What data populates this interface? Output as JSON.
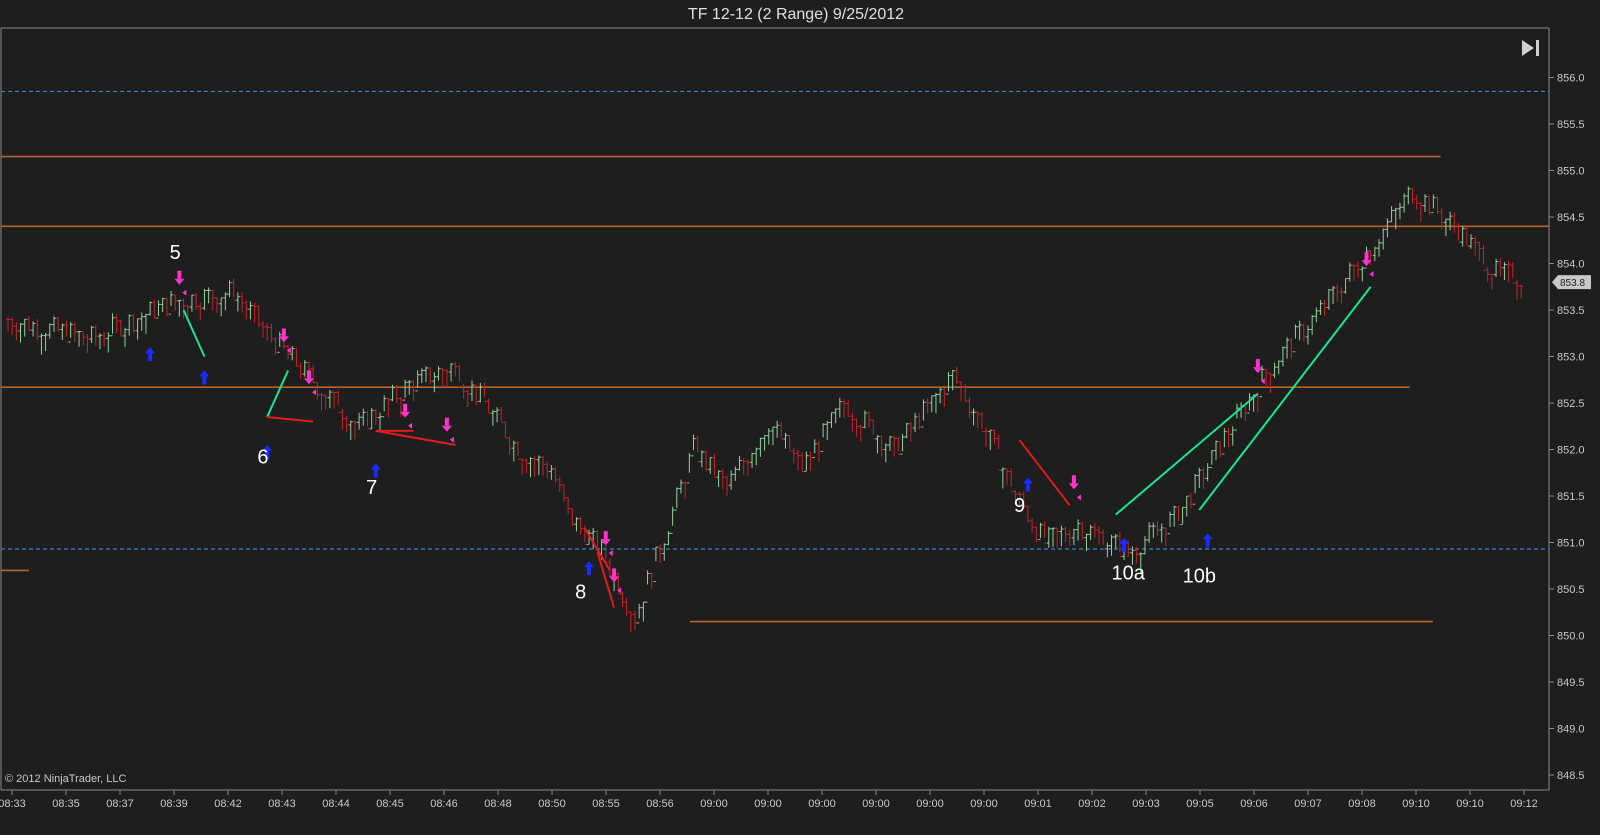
{
  "colors": {
    "background": "#1e1e1e",
    "plot_bg": "#1e1e1e",
    "axis": "#8a8a8a",
    "up_bar": "#8fd19e",
    "down_bar": "#c8222a",
    "level_line": "#b8632a",
    "dashed_line": "#3a83c9",
    "trade_win": "#19e68c",
    "trade_loss": "#e21b1b",
    "sell_marker": "#ff33cc",
    "buy_marker": "#1a2cff",
    "price_tag": "#c8c8c8"
  },
  "chart_data": {
    "type": "ohlc",
    "title": "TF 12-12 (2 Range)  9/25/2012",
    "ylim": [
      848.5,
      856.3
    ],
    "y_ticks": [
      "856.0",
      "855.5",
      "855.0",
      "854.5",
      "854.0",
      "853.5",
      "853.0",
      "852.5",
      "852.0",
      "851.5",
      "851.0",
      "850.5",
      "850.0",
      "849.5",
      "849.0",
      "848.5"
    ],
    "x_ticks": [
      "08:33",
      "08:35",
      "08:37",
      "08:39",
      "08:42",
      "08:43",
      "08:44",
      "08:45",
      "08:46",
      "08:48",
      "08:50",
      "08:55",
      "08:56",
      "09:00",
      "09:00",
      "09:00",
      "09:00",
      "09:00",
      "09:00",
      "09:01",
      "09:02",
      "09:03",
      "09:05",
      "09:06",
      "09:07",
      "09:08",
      "09:10",
      "09:10",
      "09:12"
    ],
    "last_price": "853.8",
    "copyright": "© 2012 NinjaTrader, LLC",
    "horizontal_levels": [
      {
        "price": 855.85,
        "style": "dashed",
        "from": 0,
        "to": 1
      },
      {
        "price": 855.15,
        "style": "solid",
        "from": 0,
        "to": 0.93
      },
      {
        "price": 854.4,
        "style": "solid",
        "from": 0,
        "to": 1
      },
      {
        "price": 852.67,
        "style": "solid",
        "from": 0,
        "to": 0.91
      },
      {
        "price": 850.93,
        "style": "dashed",
        "from": 0,
        "to": 1
      },
      {
        "price": 850.7,
        "style": "solid",
        "from": 0,
        "to": 0.018
      },
      {
        "price": 850.15,
        "style": "solid",
        "from": 0.445,
        "to": 0.925
      }
    ],
    "price_path": [
      [
        0,
        853.4
      ],
      [
        20,
        853.2
      ],
      [
        40,
        853.6
      ],
      [
        54,
        853.7
      ],
      [
        62,
        853.25
      ],
      [
        76,
        852.6
      ],
      [
        84,
        852.25
      ],
      [
        96,
        852.7
      ],
      [
        106,
        852.9
      ],
      [
        114,
        852.5
      ],
      [
        122,
        852.0
      ],
      [
        130,
        851.8
      ],
      [
        134,
        851.3
      ],
      [
        142,
        850.9
      ],
      [
        150,
        850.2
      ],
      [
        158,
        851.2
      ],
      [
        164,
        852.0
      ],
      [
        172,
        851.6
      ],
      [
        182,
        852.3
      ],
      [
        190,
        851.8
      ],
      [
        200,
        852.5
      ],
      [
        212,
        852.0
      ],
      [
        226,
        852.8
      ],
      [
        234,
        852.2
      ],
      [
        240,
        851.6
      ],
      [
        248,
        851.0
      ],
      [
        256,
        851.2
      ],
      [
        268,
        850.9
      ],
      [
        280,
        851.3
      ],
      [
        292,
        852.2
      ],
      [
        302,
        852.9
      ],
      [
        314,
        853.5
      ],
      [
        328,
        854.3
      ],
      [
        336,
        854.8
      ],
      [
        346,
        854.4
      ],
      [
        356,
        853.9
      ],
      [
        362,
        853.85
      ]
    ],
    "trades": [
      {
        "from": [
          42,
          853.5
        ],
        "to": [
          47,
          853.0
        ],
        "result": "win"
      },
      {
        "from": [
          62,
          852.35
        ],
        "to": [
          67,
          852.85
        ],
        "result": "win"
      },
      {
        "from": [
          62,
          852.35
        ],
        "to": [
          73,
          852.3
        ],
        "result": "loss"
      },
      {
        "from": [
          88,
          852.2
        ],
        "to": [
          97,
          852.2
        ],
        "result": "loss"
      },
      {
        "from": [
          88,
          852.2
        ],
        "to": [
          107,
          852.05
        ],
        "result": "loss"
      },
      {
        "from": [
          138,
          851.15
        ],
        "to": [
          144,
          850.7
        ],
        "result": "loss"
      },
      {
        "from": [
          141,
          850.9
        ],
        "to": [
          145,
          850.3
        ],
        "result": "loss"
      },
      {
        "from": [
          242,
          852.1
        ],
        "to": [
          254,
          851.4
        ],
        "result": "loss"
      },
      {
        "from": [
          265,
          851.3
        ],
        "to": [
          299,
          852.6
        ],
        "result": "win"
      },
      {
        "from": [
          285,
          851.35
        ],
        "to": [
          326,
          853.75
        ],
        "result": "win"
      }
    ],
    "annotations": [
      {
        "label": "5",
        "bar": 40,
        "price": 854.05
      },
      {
        "label": "6",
        "bar": 61,
        "price": 851.85
      },
      {
        "label": "7",
        "bar": 87,
        "price": 851.52
      },
      {
        "label": "8",
        "bar": 137,
        "price": 850.4
      },
      {
        "label": "9",
        "bar": 242,
        "price": 851.33
      },
      {
        "label": "10a",
        "bar": 268,
        "price": 850.6
      },
      {
        "label": "10b",
        "bar": 285,
        "price": 850.57
      }
    ],
    "sell_markers": [
      [
        41,
        853.75
      ],
      [
        66,
        853.13
      ],
      [
        72,
        852.68
      ],
      [
        95,
        852.32
      ],
      [
        105,
        852.17
      ],
      [
        143,
        850.95
      ],
      [
        145,
        850.55
      ],
      [
        255,
        851.55
      ],
      [
        299,
        852.8
      ],
      [
        325,
        853.95
      ]
    ],
    "buy_markers": [
      [
        34,
        853.1
      ],
      [
        47,
        852.85
      ],
      [
        62,
        852.05
      ],
      [
        88,
        851.85
      ],
      [
        139,
        850.8
      ],
      [
        244,
        851.7
      ],
      [
        267,
        851.05
      ],
      [
        287,
        851.1
      ]
    ]
  }
}
